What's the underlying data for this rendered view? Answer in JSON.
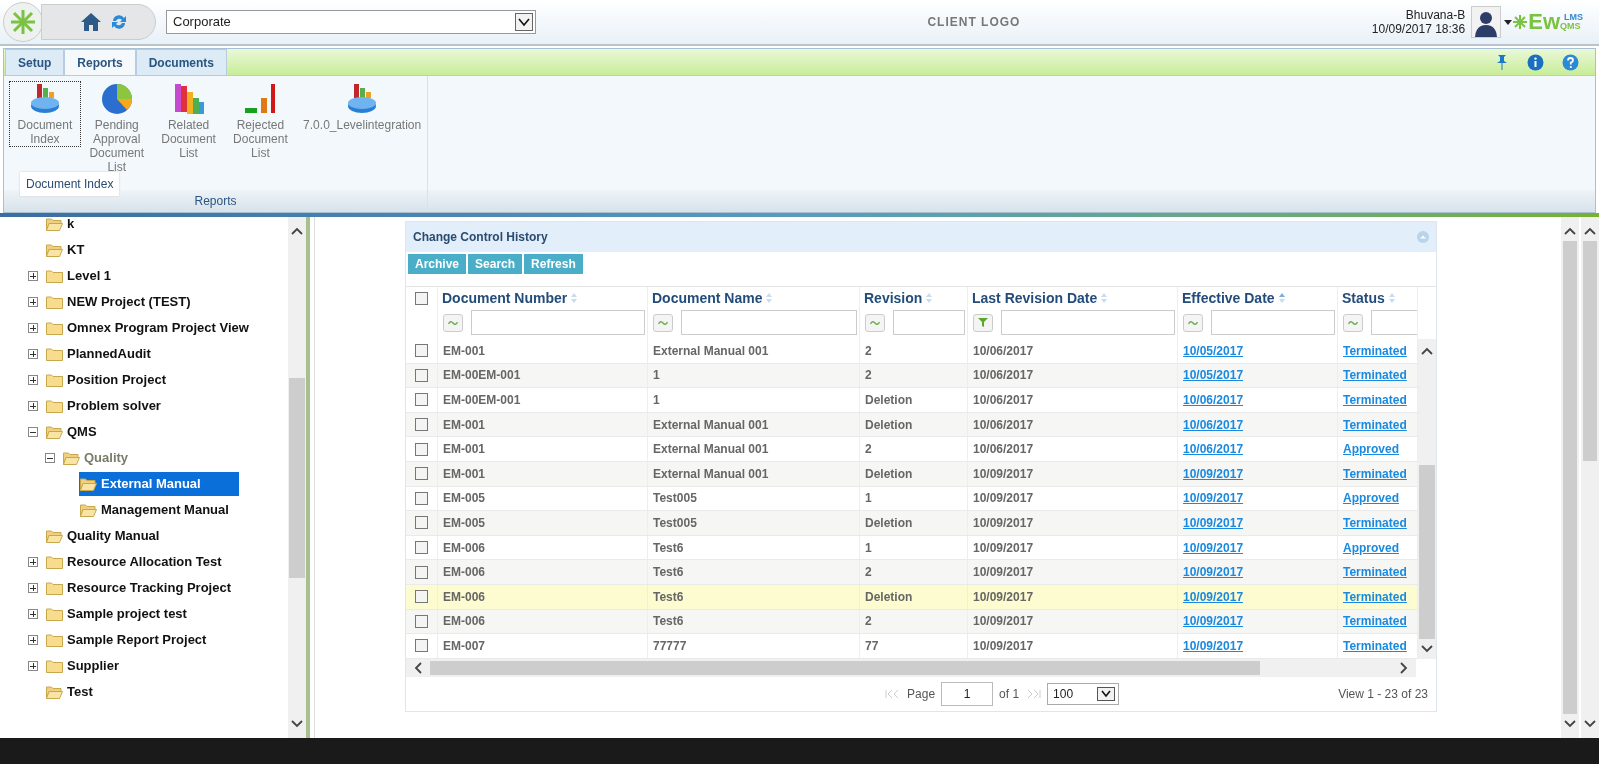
{
  "header": {
    "site_select": "Corporate",
    "client_logo": "CLIENT LOGO",
    "user_name": "Bhuvana-B",
    "datetime": "10/09/2017 18:36",
    "brand": {
      "main": "Ew",
      "upper": "LMS",
      "lower": "QMS"
    }
  },
  "ribbon": {
    "tabs": [
      {
        "label": "Setup",
        "selected": false
      },
      {
        "label": "Reports",
        "selected": true
      },
      {
        "label": "Documents",
        "selected": false
      }
    ],
    "items": [
      {
        "label": "Document Index",
        "kind": "index",
        "focused": true
      },
      {
        "label": "Pending Approval Document List",
        "kind": "pie",
        "focused": false
      },
      {
        "label": "Related Document List",
        "kind": "bars",
        "focused": false
      },
      {
        "label": "Rejected Document List",
        "kind": "rising",
        "focused": false
      },
      {
        "label": "7.0.0_Levelintegration",
        "kind": "index",
        "focused": false
      }
    ],
    "tooltip": "Document Index",
    "group_label": "Reports"
  },
  "tree": [
    {
      "label": "k",
      "kind": "leaf",
      "selected": false,
      "dimmed": false
    },
    {
      "label": "KT",
      "kind": "leaf",
      "selected": false,
      "dimmed": false
    },
    {
      "label": "Level 1",
      "kind": "branch",
      "expanded": false,
      "selected": false,
      "dimmed": false
    },
    {
      "label": "NEW Project (TEST)",
      "kind": "branch",
      "expanded": false,
      "selected": false,
      "dimmed": false
    },
    {
      "label": "Omnex Program Project View",
      "kind": "branch",
      "expanded": false,
      "selected": false,
      "dimmed": false
    },
    {
      "label": "PlannedAudit",
      "kind": "branch",
      "expanded": false,
      "selected": false,
      "dimmed": false
    },
    {
      "label": "Position Project",
      "kind": "branch",
      "expanded": false,
      "selected": false,
      "dimmed": false
    },
    {
      "label": "Problem solver",
      "kind": "branch",
      "expanded": false,
      "selected": false,
      "dimmed": false
    },
    {
      "label": "QMS",
      "kind": "branch",
      "expanded": true,
      "selected": false,
      "dimmed": false,
      "children": [
        {
          "label": "Quality",
          "kind": "branch",
          "expanded": true,
          "selected": false,
          "dimmed": true,
          "children": [
            {
              "label": "External Manual",
              "kind": "leaf",
              "selected": true,
              "dimmed": false
            },
            {
              "label": "Management Manual",
              "kind": "leaf",
              "selected": false,
              "dimmed": false
            }
          ]
        }
      ]
    },
    {
      "label": "Quality Manual",
      "kind": "leaf",
      "selected": false,
      "dimmed": false
    },
    {
      "label": "Resource Allocation Test",
      "kind": "branch",
      "expanded": false,
      "selected": false,
      "dimmed": false
    },
    {
      "label": "Resource Tracking Project",
      "kind": "branch",
      "expanded": false,
      "selected": false,
      "dimmed": false
    },
    {
      "label": "Sample project test",
      "kind": "branch",
      "expanded": false,
      "selected": false,
      "dimmed": false
    },
    {
      "label": "Sample Report Project",
      "kind": "branch",
      "expanded": false,
      "selected": false,
      "dimmed": false
    },
    {
      "label": "Supplier",
      "kind": "branch",
      "expanded": false,
      "selected": false,
      "dimmed": false
    },
    {
      "label": "Test",
      "kind": "leaf",
      "selected": false,
      "dimmed": false
    }
  ],
  "grid": {
    "title": "Change Control History",
    "buttons": [
      "Archive",
      "Search",
      "Refresh"
    ],
    "select_all_checked": false,
    "columns": [
      {
        "label": "Document Number",
        "kind": "contains",
        "sorted": false
      },
      {
        "label": "Document Name",
        "kind": "contains",
        "sorted": false
      },
      {
        "label": "Revision",
        "kind": "contains",
        "sorted": false
      },
      {
        "label": "Last Revision Date",
        "kind": "funnel",
        "sorted": false
      },
      {
        "label": "Effective Date",
        "kind": "contains",
        "sorted": true
      },
      {
        "label": "Status",
        "kind": "contains",
        "sorted": false
      }
    ],
    "rows": [
      {
        "cells": [
          "EM-001",
          "External Manual 001",
          "2",
          "10/06/2017",
          "10/05/2017",
          "Terminated"
        ],
        "checked": false,
        "highlighted": false
      },
      {
        "cells": [
          "EM-00EM-001",
          "1",
          "2",
          "10/06/2017",
          "10/05/2017",
          "Terminated"
        ],
        "checked": false,
        "highlighted": false
      },
      {
        "cells": [
          "EM-00EM-001",
          "1",
          "Deletion",
          "10/06/2017",
          "10/06/2017",
          "Terminated"
        ],
        "checked": false,
        "highlighted": false
      },
      {
        "cells": [
          "EM-001",
          "External Manual 001",
          "Deletion",
          "10/06/2017",
          "10/06/2017",
          "Terminated"
        ],
        "checked": false,
        "highlighted": false
      },
      {
        "cells": [
          "EM-001",
          "External Manual 001",
          "2",
          "10/06/2017",
          "10/06/2017",
          "Approved"
        ],
        "checked": false,
        "highlighted": false
      },
      {
        "cells": [
          "EM-001",
          "External Manual 001",
          "Deletion",
          "10/09/2017",
          "10/09/2017",
          "Terminated"
        ],
        "checked": false,
        "highlighted": false
      },
      {
        "cells": [
          "EM-005",
          "Test005",
          "1",
          "10/09/2017",
          "10/09/2017",
          "Approved"
        ],
        "checked": false,
        "highlighted": false
      },
      {
        "cells": [
          "EM-005",
          "Test005",
          "Deletion",
          "10/09/2017",
          "10/09/2017",
          "Terminated"
        ],
        "checked": false,
        "highlighted": false
      },
      {
        "cells": [
          "EM-006",
          "Test6",
          "1",
          "10/09/2017",
          "10/09/2017",
          "Approved"
        ],
        "checked": false,
        "highlighted": false
      },
      {
        "cells": [
          "EM-006",
          "Test6",
          "2",
          "10/09/2017",
          "10/09/2017",
          "Terminated"
        ],
        "checked": false,
        "highlighted": false
      },
      {
        "cells": [
          "EM-006",
          "Test6",
          "Deletion",
          "10/09/2017",
          "10/09/2017",
          "Terminated"
        ],
        "checked": false,
        "highlighted": true
      },
      {
        "cells": [
          "EM-006",
          "Test6",
          "2",
          "10/09/2017",
          "10/09/2017",
          "Terminated"
        ],
        "checked": false,
        "highlighted": false
      },
      {
        "cells": [
          "EM-007",
          "77777",
          "77",
          "10/09/2017",
          "10/09/2017",
          "Terminated"
        ],
        "checked": false,
        "highlighted": false
      }
    ],
    "pager": {
      "page_label": "Page",
      "page": "1",
      "of": "of 1",
      "page_size": "100",
      "summary": "View 1 - 23 of 23"
    }
  }
}
